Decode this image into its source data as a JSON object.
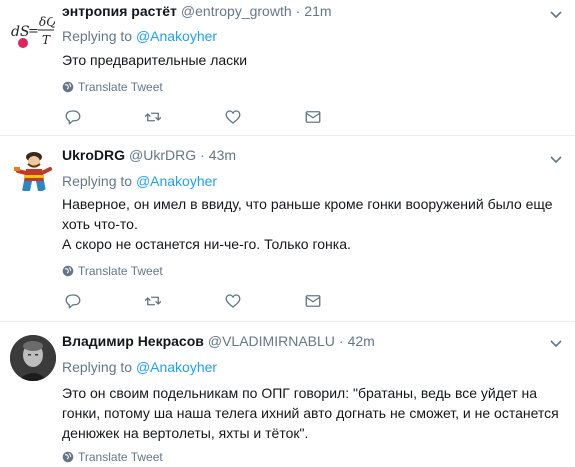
{
  "tweets": [
    {
      "name": "энтропия растёт",
      "handle": "@entropy_growth",
      "time": "21m",
      "replying_prefix": "Replying to",
      "replying_to": "@Anakoyher",
      "text": [
        "Это предварительные ласки"
      ],
      "translate": "Translate Tweet",
      "avatar_formula": {
        "lhs": "dS",
        "eq": "=",
        "num": "δQ",
        "den": "T"
      }
    },
    {
      "name": "UkroDRG",
      "handle": "@UkrDRG",
      "time": "43m",
      "replying_prefix": "Replying to",
      "replying_to": "@Anakoyher",
      "text": [
        "Наверное, он имел в ввиду, что раньше кроме гонки вооружений было еще хоть что-то.",
        "А скоро не останется ни-че-го. Только гонка."
      ],
      "translate": "Translate Tweet"
    },
    {
      "name": "Владимир Некрасов",
      "handle": "@VLADIMIRNABLU",
      "time": "42m",
      "replying_prefix": "Replying to",
      "replying_to": "@Anakoyher",
      "text": [
        "Это он своим подельникам по ОПГ говорил: \"братаны, ведь все уйдет на гонки, потому ша наша телега ихний авто догнать не сможет, и не останется денюжек на вертолеты, яхты и тёток\"."
      ],
      "translate": "Translate Tweet"
    }
  ],
  "separator": "·",
  "colors": {
    "text": "#14171a",
    "secondary": "#657786",
    "link": "#1da1f2",
    "border": "#e6ecf0"
  },
  "icons": [
    "reply-icon",
    "retweet-icon",
    "like-icon",
    "direct-message-icon",
    "globe-icon",
    "chevron-down-icon"
  ]
}
